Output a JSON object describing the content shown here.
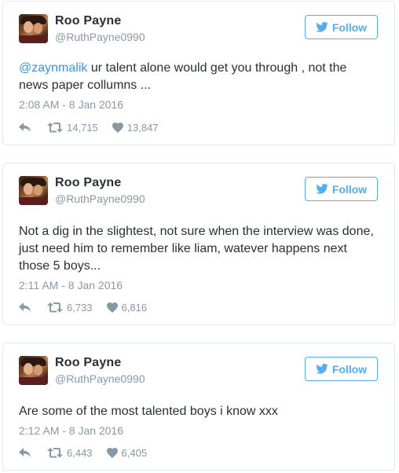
{
  "colors": {
    "accent": "#55acee",
    "mention": "#3b94d9",
    "muted": "#8899a6",
    "text": "#292f33",
    "border": "#e1e8ed"
  },
  "tweets": [
    {
      "name": "Roo Payne",
      "handle": "@RuthPayne0990",
      "follow_label": "Follow",
      "mention": "@zaynmalik",
      "text": " ur talent alone would get you through , not the news paper collumns ...",
      "time": "2:08 AM - 8 Jan 2016",
      "retweets": "14,715",
      "likes": "13,847"
    },
    {
      "name": "Roo Payne",
      "handle": "@RuthPayne0990",
      "follow_label": "Follow",
      "mention": "",
      "text": "Not a dig in the slightest, not sure when the interview was done, just need him to remember like liam, watever happens next those 5 boys...",
      "time": "2:11 AM - 8 Jan 2016",
      "retweets": "6,733",
      "likes": "6,816"
    },
    {
      "name": "Roo Payne",
      "handle": "@RuthPayne0990",
      "follow_label": "Follow",
      "mention": "",
      "text": "Are some of the most talented boys i know xxx",
      "time": "2:12 AM - 8 Jan 2016",
      "retweets": "6,443",
      "likes": "6,405"
    }
  ],
  "icons": {
    "follow": "twitter-bird-icon",
    "reply": "reply-icon",
    "retweet": "retweet-icon",
    "like": "heart-icon"
  }
}
